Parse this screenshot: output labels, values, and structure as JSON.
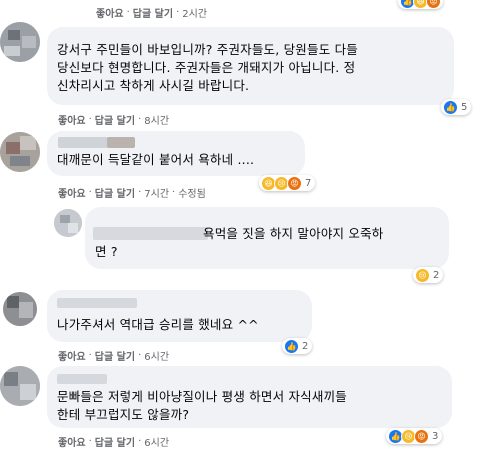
{
  "labels": {
    "like": "좋아요",
    "reply": "답글 달기",
    "sep": "·"
  },
  "comments": [
    {
      "time": "2시간",
      "reaction_count": ""
    },
    {
      "text": "강서구 주민들이 바보입니까? 주권자들도, 당원들도 다들 당신보다 현명합니다. 주권자들은 개돼지가 아닙니다. 정신차리시고 착하게 사시길 바랍니다.",
      "lines": [
        "강서구 주민들이 바보입니까? 주권자들도, 당원들도 다들",
        "당신보다 현명합니다. 주권자들은 개돼지가 아닙니다. 정",
        "신차리시고 착하게 사시길 바랍니다."
      ],
      "time": "8시간",
      "reaction_count": "5"
    },
    {
      "text": "대깨문이 득달같이 붙어서 욕하네 ....",
      "time": "7시간",
      "edited": "수정됨",
      "reaction_count": "7"
    },
    {
      "lines": [
        "욕먹을 짓을 하지 말아야지 오죽하",
        "면 ?"
      ],
      "reaction_count": "2"
    },
    {
      "text": "나가주셔서 역대급 승리를 했네요 ^^",
      "time": "6시간",
      "reaction_count": "2"
    },
    {
      "lines": [
        "문빠들은 저렇게 비아냥질이나 평생 하면서 자식새끼들",
        "한테 부끄럽지도 않을까?"
      ],
      "time": "6시간",
      "reaction_count": "3"
    }
  ],
  "colors": {
    "like": "#1877f2",
    "haha": "#f7b928",
    "angry": "#e9710f",
    "bubble": "#f0f2f5",
    "meta": "#65676b"
  }
}
